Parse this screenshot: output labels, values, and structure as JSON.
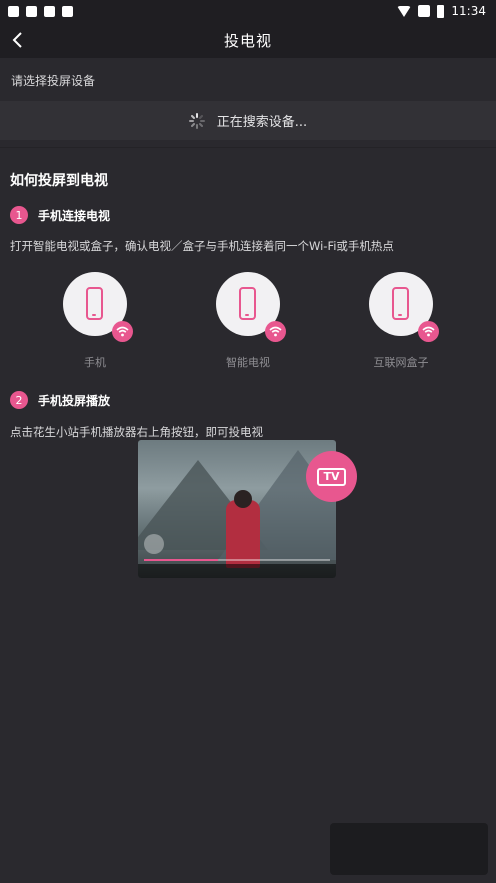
{
  "status_bar": {
    "time": "11:34"
  },
  "header": {
    "title": "投电视"
  },
  "device_select": {
    "label": "请选择投屏设备",
    "searching_text": "正在搜索设备..."
  },
  "guide": {
    "title": "如何投屏到电视",
    "steps": [
      {
        "number": "1",
        "label": "手机连接电视",
        "description": "打开智能电视或盒子，确认电视／盒子与手机连接着同一个Wi-Fi或手机热点"
      },
      {
        "number": "2",
        "label": "手机投屏播放",
        "description": "点击花生小站手机播放器右上角按钮，即可投电视"
      }
    ],
    "devices": [
      {
        "label": "手机"
      },
      {
        "label": "智能电视"
      },
      {
        "label": "互联网盒子"
      }
    ],
    "tv_button_text": "TV"
  },
  "colors": {
    "accent": "#e8578f",
    "background": "#2a292e",
    "bar": "#1f1e22"
  }
}
